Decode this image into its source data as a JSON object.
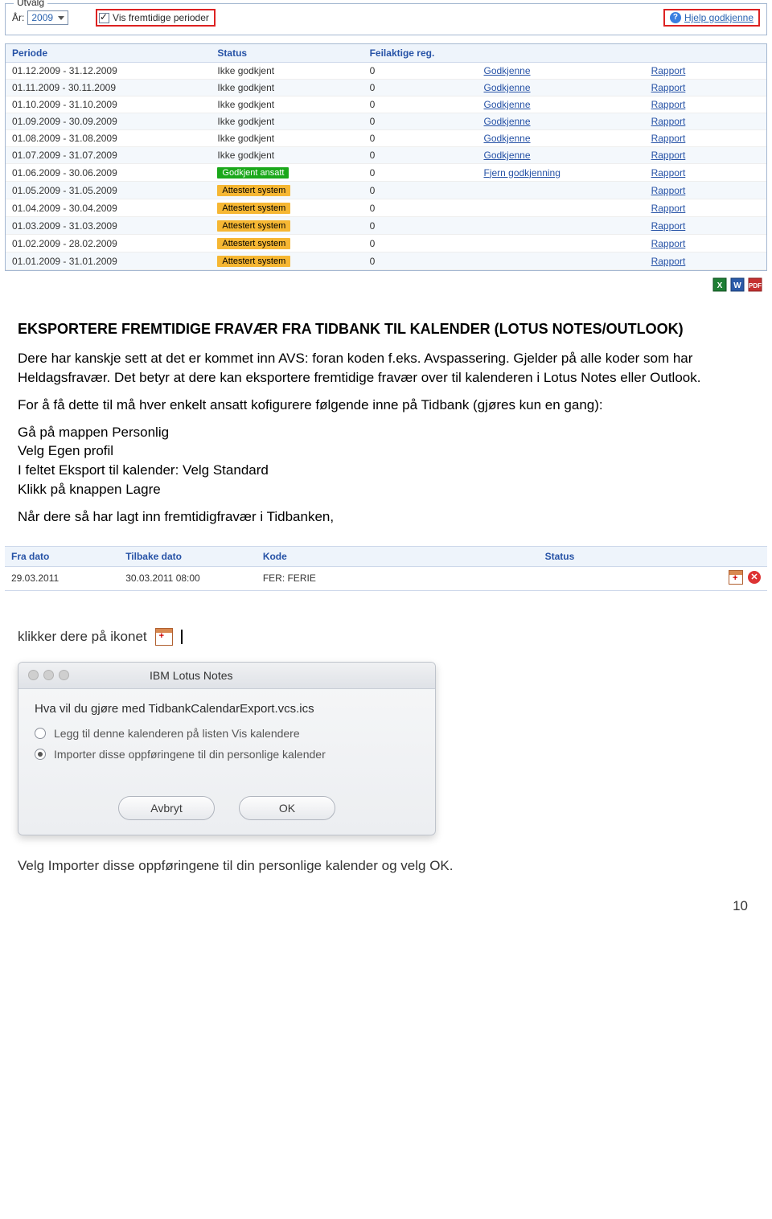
{
  "fieldset": {
    "legend": "Utvalg",
    "year_label": "År:",
    "year_value": "2009",
    "future_checkbox_label": "Vis fremtidige perioder",
    "help_label": "Hjelp godkjenne"
  },
  "table": {
    "headers": {
      "periode": "Periode",
      "status": "Status",
      "feil": "Feilaktige reg."
    },
    "rows": [
      {
        "periode": "01.12.2009 - 31.12.2009",
        "status": "Ikke godkjent",
        "status_style": "",
        "feil": "0",
        "a1": "Godkjenne",
        "a2": "Rapport"
      },
      {
        "periode": "01.11.2009 - 30.11.2009",
        "status": "Ikke godkjent",
        "status_style": "",
        "feil": "0",
        "a1": "Godkjenne",
        "a2": "Rapport"
      },
      {
        "periode": "01.10.2009 - 31.10.2009",
        "status": "Ikke godkjent",
        "status_style": "",
        "feil": "0",
        "a1": "Godkjenne",
        "a2": "Rapport"
      },
      {
        "periode": "01.09.2009 - 30.09.2009",
        "status": "Ikke godkjent",
        "status_style": "",
        "feil": "0",
        "a1": "Godkjenne",
        "a2": "Rapport"
      },
      {
        "periode": "01.08.2009 - 31.08.2009",
        "status": "Ikke godkjent",
        "status_style": "",
        "feil": "0",
        "a1": "Godkjenne",
        "a2": "Rapport"
      },
      {
        "periode": "01.07.2009 - 31.07.2009",
        "status": "Ikke godkjent",
        "status_style": "",
        "feil": "0",
        "a1": "Godkjenne",
        "a2": "Rapport"
      },
      {
        "periode": "01.06.2009 - 30.06.2009",
        "status": "Godkjent ansatt",
        "status_style": "green",
        "feil": "0",
        "a1": "Fjern godkjenning",
        "a2": "Rapport"
      },
      {
        "periode": "01.05.2009 - 31.05.2009",
        "status": "Attestert system",
        "status_style": "orange",
        "feil": "0",
        "a1": "",
        "a2": "Rapport"
      },
      {
        "periode": "01.04.2009 - 30.04.2009",
        "status": "Attestert system",
        "status_style": "orange",
        "feil": "0",
        "a1": "",
        "a2": "Rapport"
      },
      {
        "periode": "01.03.2009 - 31.03.2009",
        "status": "Attestert system",
        "status_style": "orange",
        "feil": "0",
        "a1": "",
        "a2": "Rapport"
      },
      {
        "periode": "01.02.2009 - 28.02.2009",
        "status": "Attestert system",
        "status_style": "orange",
        "feil": "0",
        "a1": "",
        "a2": "Rapport"
      },
      {
        "periode": "01.01.2009 - 31.01.2009",
        "status": "Attestert system",
        "status_style": "orange",
        "feil": "0",
        "a1": "",
        "a2": "Rapport"
      }
    ]
  },
  "doc": {
    "title": "EKSPORTERE FREMTIDIGE FRAVÆR FRA TIDBANK TIL KALENDER (LOTUS NOTES/OUTLOOK)",
    "p1": "Dere har kanskje sett at det er kommet inn AVS: foran koden f.eks. Avspassering. Gjelder på alle koder som har Heldagsfravær. Det betyr at dere kan eksportere fremtidige fravær over til kalenderen i Lotus Notes eller Outlook.",
    "p2": "For å få dette til må hver enkelt ansatt kofigurere følgende inne på Tidbank (gjøres kun en gang):",
    "l1": "Gå på mappen Personlig",
    "l2": "Velg Egen profil",
    "l3": "I feltet Eksport til kalender: Velg Standard",
    "l4": "Klikk på knappen Lagre",
    "p3": "Når dere så har lagt inn fremtidigfravær i Tidbanken,"
  },
  "entry": {
    "headers": {
      "fra": "Fra dato",
      "tilbake": "Tilbake dato",
      "kode": "Kode",
      "status": "Status"
    },
    "row": {
      "fra": "29.03.2011",
      "tilbake": "30.03.2011 08:00",
      "kode": "FER: FERIE",
      "status": ""
    }
  },
  "click_text": "klikker dere på ikonet",
  "dialog": {
    "title": "IBM Lotus Notes",
    "question": "Hva vil du gjøre med TidbankCalendarExport.vcs.ics",
    "opt1": "Legg til denne kalenderen på listen Vis kalendere",
    "opt2": "Importer disse oppføringene til din personlige kalender",
    "btn_cancel": "Avbryt",
    "btn_ok": "OK"
  },
  "final_text": "Velg Importer disse oppføringene til din personlige kalender og velg OK.",
  "page_number": "10"
}
